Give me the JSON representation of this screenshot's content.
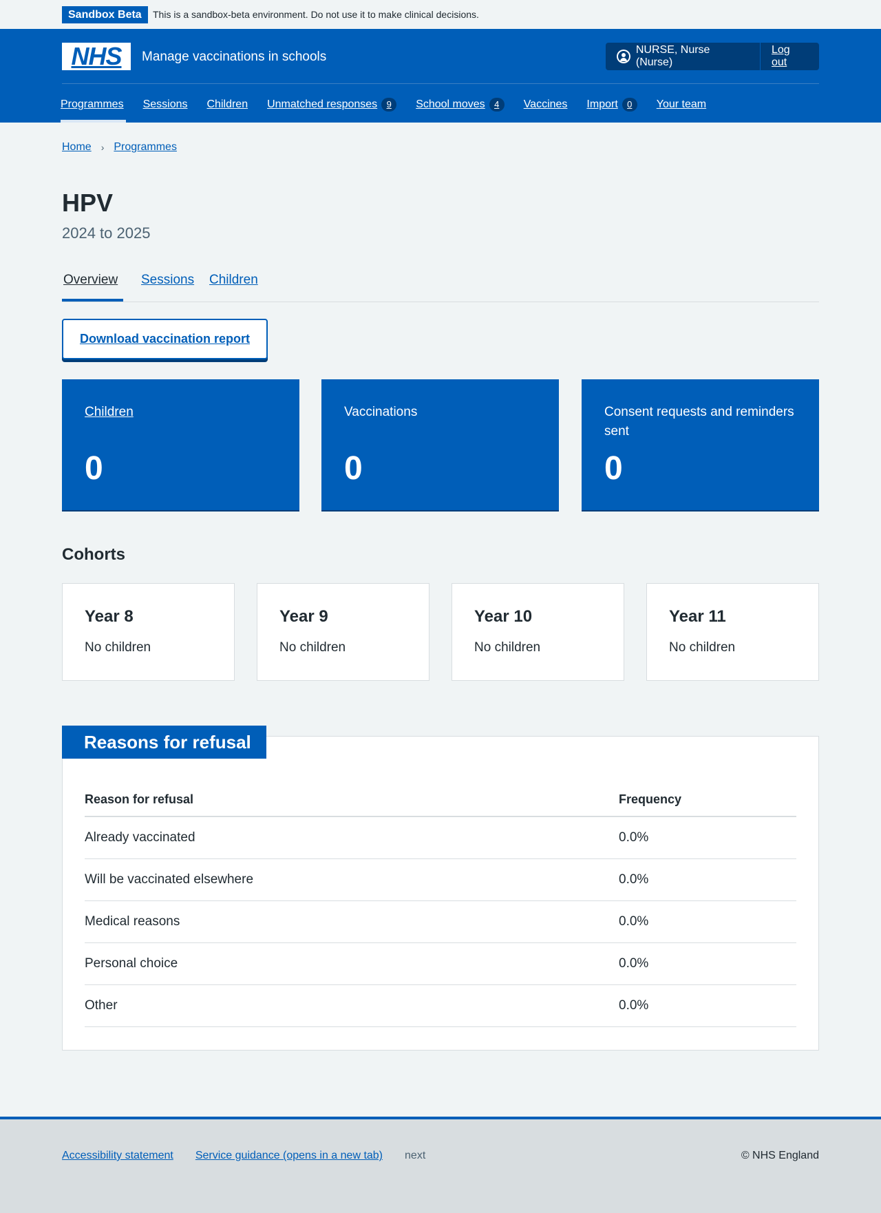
{
  "beta_banner": {
    "tag": "Sandbox Beta",
    "message": "This is a sandbox-beta environment. Do not use it to make clinical decisions."
  },
  "header": {
    "logo": "NHS",
    "service_name": "Manage vaccinations in schools",
    "user": "NURSE, Nurse (Nurse)",
    "logout": "Log out",
    "nav": [
      {
        "label": "Programmes",
        "count": null
      },
      {
        "label": "Sessions",
        "count": null
      },
      {
        "label": "Children",
        "count": null
      },
      {
        "label": "Unmatched responses",
        "count": "9"
      },
      {
        "label": "School moves",
        "count": "4"
      },
      {
        "label": "Vaccines",
        "count": null
      },
      {
        "label": "Import",
        "count": "0"
      },
      {
        "label": "Your team",
        "count": null
      }
    ]
  },
  "breadcrumb": [
    "Home",
    "Programmes"
  ],
  "page": {
    "title": "HPV",
    "subtitle": "2024 to 2025",
    "tabs": [
      "Overview",
      "Sessions",
      "Children"
    ],
    "download_button": "Download vaccination report"
  },
  "stats": [
    {
      "label": "Children",
      "value": "0"
    },
    {
      "label": "Vaccinations",
      "value": "0"
    },
    {
      "label": "Consent requests and reminders sent",
      "value": "0"
    }
  ],
  "cohorts": {
    "heading": "Cohorts",
    "items": [
      {
        "year": "Year 8",
        "status": "No children"
      },
      {
        "year": "Year 9",
        "status": "No children"
      },
      {
        "year": "Year 10",
        "status": "No children"
      },
      {
        "year": "Year 11",
        "status": "No children"
      }
    ]
  },
  "refusal": {
    "heading": "Reasons for refusal",
    "columns": [
      "Reason for refusal",
      "Frequency"
    ],
    "rows": [
      {
        "reason": "Already vaccinated",
        "frequency": "0.0%"
      },
      {
        "reason": "Will be vaccinated elsewhere",
        "frequency": "0.0%"
      },
      {
        "reason": "Medical reasons",
        "frequency": "0.0%"
      },
      {
        "reason": "Personal choice",
        "frequency": "0.0%"
      },
      {
        "reason": "Other",
        "frequency": "0.0%"
      }
    ]
  },
  "footer": {
    "links": [
      "Accessibility statement",
      "Service guidance (opens in a new tab)"
    ],
    "env": "next",
    "copyright": "© NHS England"
  }
}
